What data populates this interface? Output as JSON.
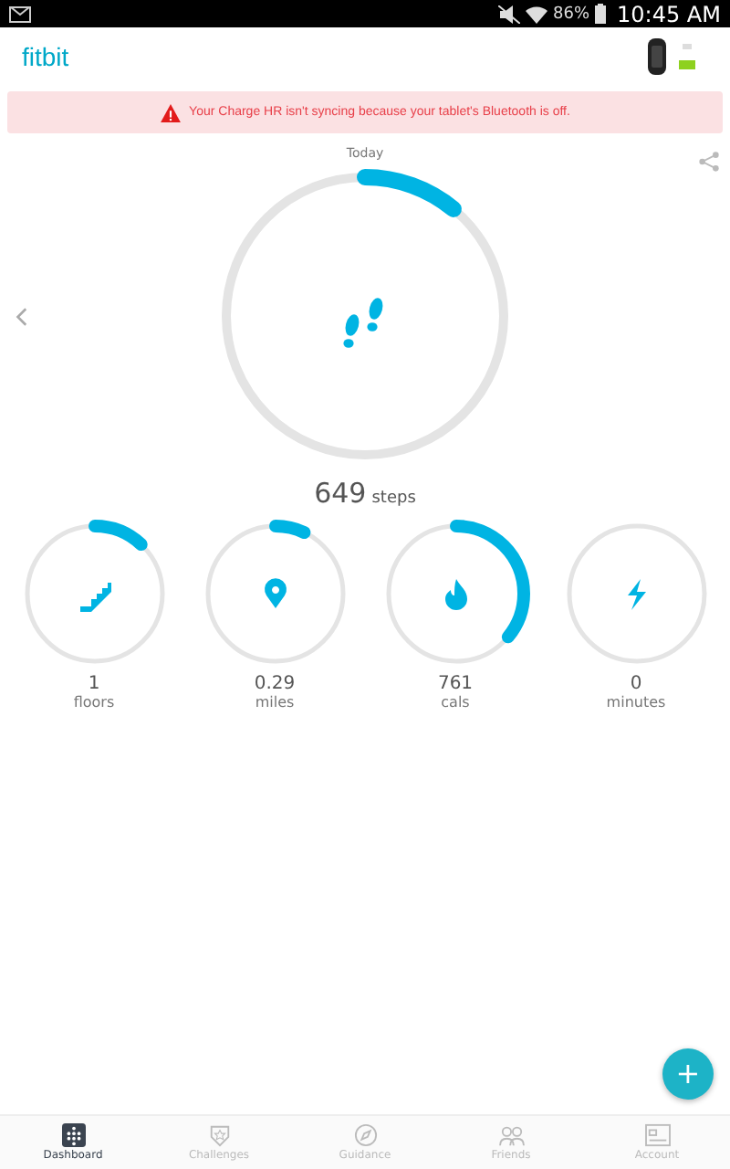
{
  "status_bar": {
    "battery": "86%",
    "time": "10:45 AM"
  },
  "header": {
    "logo": "fitbit"
  },
  "alert": {
    "message": "Your Charge HR isn't syncing because your tablet's Bluetooth is off."
  },
  "day": {
    "label": "Today"
  },
  "main_goal": {
    "value": "649",
    "unit": "steps",
    "level": 0.11
  },
  "stats": [
    {
      "kind": "floors",
      "value": "1",
      "unit": "floors",
      "level": 0.12
    },
    {
      "kind": "distance",
      "value": "0.29",
      "unit": "miles",
      "level": 0.07
    },
    {
      "kind": "calories",
      "value": "761",
      "unit": "cals",
      "level": 0.36
    },
    {
      "kind": "active",
      "value": "0",
      "unit": "minutes"
    }
  ],
  "fab": {
    "label": "+"
  },
  "nav": [
    {
      "kind": "dashboard",
      "label": "Dashboard",
      "selected": true
    },
    {
      "kind": "challenges",
      "label": "Challenges",
      "selected": false
    },
    {
      "kind": "guidance",
      "label": "Guidance",
      "selected": false
    },
    {
      "kind": "friends",
      "label": "Friends",
      "selected": false
    },
    {
      "kind": "account",
      "label": "Account",
      "selected": false
    }
  ]
}
